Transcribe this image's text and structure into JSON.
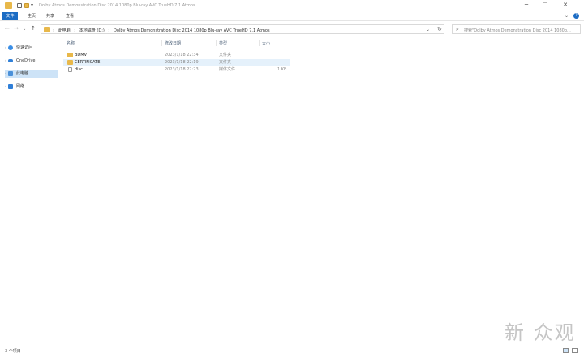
{
  "window": {
    "title": "Dolby Atmos Demonstration Disc 2014 1080p Blu-ray AVC TrueHD 7.1 Atmos",
    "minimize": "─",
    "maximize": "☐",
    "close": "✕"
  },
  "ribbon": {
    "tabs": [
      "文件",
      "主页",
      "共享",
      "查看"
    ],
    "expand": "⌄",
    "help": "?"
  },
  "nav": {
    "back": "←",
    "forward": "→",
    "recent": "⌄",
    "up": "↑"
  },
  "address": {
    "crumbs": [
      "此电脑",
      "本地磁盘 (D:)",
      "Dolby Atmos Demonstration Disc 2014 1080p Blu-ray AVC TrueHD 7.1 Atmos"
    ],
    "separator": "›",
    "dropdown": "⌄",
    "refresh": "↻"
  },
  "search": {
    "placeholder": "搜索\"Dolby Atmos Demonstration Disc 2014 1080p...",
    "icon": "search-icon"
  },
  "sidebar": {
    "items": [
      {
        "label": "快速访问",
        "icon": "star-icon"
      },
      {
        "label": "OneDrive",
        "icon": "cloud-icon"
      },
      {
        "label": "此电脑",
        "icon": "computer-icon"
      },
      {
        "label": "网络",
        "icon": "network-icon"
      }
    ]
  },
  "columns": {
    "name": "名称",
    "date": "修改日期",
    "type": "类型",
    "size": "大小"
  },
  "files": [
    {
      "name": "BDMV",
      "date": "2023/1/18 22:34",
      "type": "文件夹",
      "size": ""
    },
    {
      "name": "CERTIFICATE",
      "date": "2023/1/18 22:19",
      "type": "文件夹",
      "size": ""
    },
    {
      "name": "disc",
      "date": "2023/1/18 22:23",
      "type": "媒体文件",
      "size": "1 KB"
    }
  ],
  "status": {
    "count": "3 个项目"
  },
  "watermark": {
    "text": "新 众观"
  },
  "colors": {
    "accent": "#1c6cc4",
    "folder": "#e8b84a",
    "selection": "#cde3f7"
  }
}
